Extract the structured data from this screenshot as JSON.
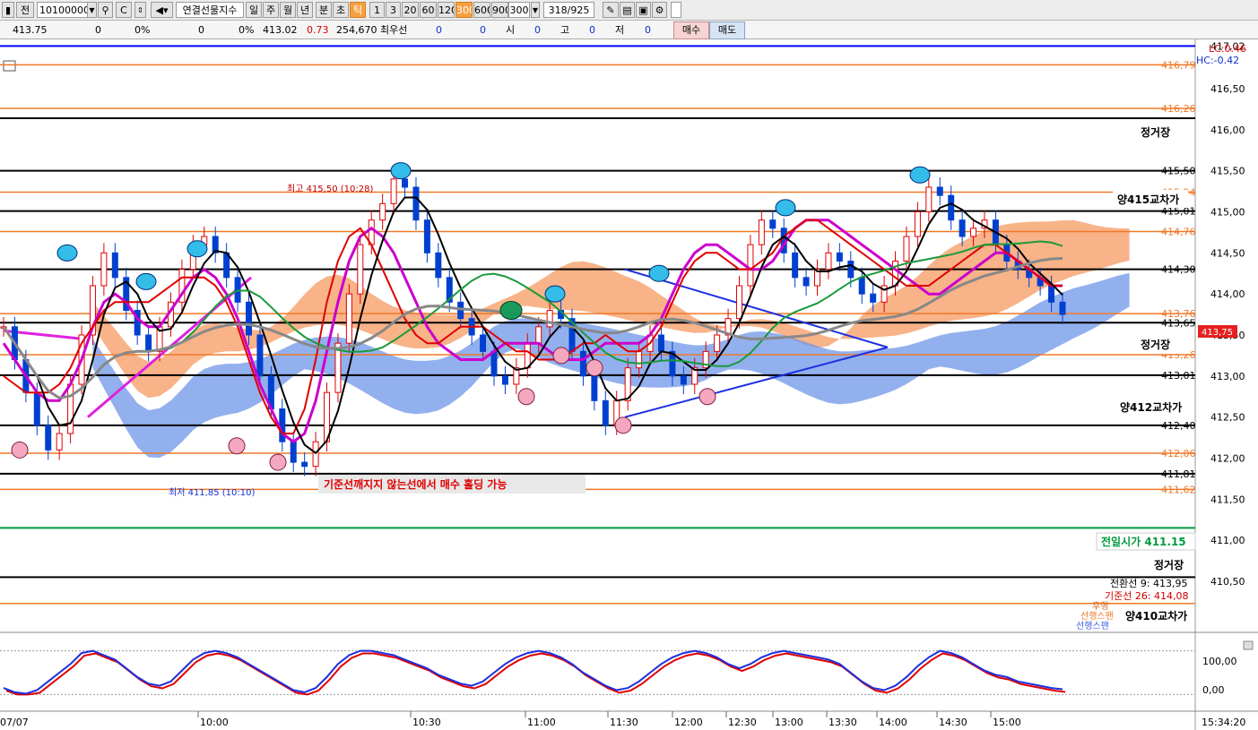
{
  "toolbar": {
    "code": "10100000",
    "name": "연결선물지수",
    "jeon_label": "전",
    "periods": [
      "일",
      "주",
      "월",
      "년",
      "분",
      "초",
      "틱"
    ],
    "intervals": [
      "1",
      "3",
      "20",
      "60",
      "120",
      "300",
      "600",
      "900"
    ],
    "selected_interval": "300",
    "interval_value": "300",
    "bar_count": "318/925"
  },
  "quote": {
    "current": "413.75",
    "v1": "0",
    "p1": "0%",
    "v2": "0",
    "p2": "0%",
    "price": "413.02",
    "change": "0.73",
    "volume": "254,670",
    "best_label": "최우선",
    "best_v1": "0",
    "best_v2": "0",
    "open_label": "시",
    "open": "0",
    "high_label": "고",
    "high": "0",
    "low_label": "저",
    "low": "0",
    "buy_label": "매수",
    "sell_label": "매도"
  },
  "colors": {
    "orange_line": "#f07828",
    "blue_line": "#0000ff",
    "green_line": "#009a3e",
    "current_price_bg": "#e62020",
    "candle_up": "#e00000",
    "candle_down": "#0040d0"
  },
  "chart_data": {
    "type": "line",
    "title": "",
    "ylim": [
      409.9,
      417.1
    ],
    "y_ticks": [
      "417,02",
      "416,50",
      "416,00",
      "415,50",
      "415,00",
      "414,50",
      "414,00",
      "413,50",
      "413,00",
      "412,50",
      "412,00",
      "411,50",
      "411,00",
      "410,50"
    ],
    "x_ticks": [
      "07/07",
      "10:00",
      "10:30",
      "11:00",
      "11:30",
      "12:00",
      "12:30",
      "13:00",
      "13:30",
      "14:00",
      "14:30",
      "15:00",
      "15:34:20"
    ],
    "price_scale_labels": {
      "lc": "LC:0.46",
      "hc": "HC:-0.42",
      "o1": "416,79",
      "o2": "416,26",
      "o3": "415,24",
      "o4": "414,76",
      "o5": "413,76",
      "o6": "413,26",
      "o7": "412,06",
      "o8": "411,62",
      "b1": "415,50",
      "b2": "415,01",
      "b3": "414,30",
      "b4": "413,01",
      "b5": "412,40",
      "b6": "411,81",
      "b7": "413,65",
      "pct": "0.00%"
    },
    "current_price": "413,75",
    "horizontal_lines": [
      {
        "color": "blue",
        "value": 417.02
      },
      {
        "color": "orange",
        "value": 416.79
      },
      {
        "color": "orange",
        "value": 416.26
      },
      {
        "color": "black",
        "value": 416.14
      },
      {
        "color": "black",
        "value": 415.5
      },
      {
        "color": "orange",
        "value": 415.24
      },
      {
        "color": "black",
        "value": 415.01
      },
      {
        "color": "orange",
        "value": 414.76
      },
      {
        "color": "black",
        "value": 414.3
      },
      {
        "color": "orange",
        "value": 413.76
      },
      {
        "color": "black",
        "value": 413.65
      },
      {
        "color": "orange",
        "value": 413.26
      },
      {
        "color": "black",
        "value": 413.01
      },
      {
        "color": "black",
        "value": 412.4
      },
      {
        "color": "orange",
        "value": 412.06
      },
      {
        "color": "black",
        "value": 411.81
      },
      {
        "color": "orange",
        "value": 411.62
      },
      {
        "color": "green",
        "value": 411.15
      },
      {
        "color": "black",
        "value": 410.55
      },
      {
        "color": "orange",
        "value": 410.23
      }
    ],
    "annotations": {
      "regular1": "정거장",
      "regular2": "정거장",
      "regular3": "정거장",
      "cross415": "양415교차가",
      "cross412": "양412교차가",
      "cross410": "양410교차가",
      "prev_close": "전일시가 411.15",
      "high_note": "최고 415,50 (10:28)",
      "low_note": "최저 411,85 (10:10)",
      "strategy": "기준선깨지지 않는선에서 매수 홀딩 가능",
      "conv": "전환선 9: 413,95",
      "base": "기준선 26: 414,08",
      "lead1": "후행",
      "lead2": "선행스팬",
      "lead3": "선행스팬"
    },
    "prices": [
      413.6,
      413.2,
      412.8,
      412.4,
      412.1,
      412.3,
      412.9,
      413.5,
      414.1,
      414.5,
      414.2,
      413.8,
      413.5,
      413.3,
      413.6,
      413.9,
      414.3,
      414.6,
      414.7,
      414.5,
      414.2,
      413.9,
      413.5,
      413.0,
      412.6,
      412.2,
      411.95,
      411.9,
      412.2,
      412.8,
      413.4,
      414.0,
      414.6,
      414.9,
      415.1,
      415.4,
      415.3,
      414.9,
      414.5,
      414.2,
      413.9,
      413.7,
      413.5,
      413.3,
      413.0,
      412.9,
      413.1,
      413.4,
      413.6,
      413.8,
      413.7,
      413.3,
      413.0,
      412.7,
      412.4,
      412.7,
      413.1,
      413.3,
      413.5,
      413.3,
      413.0,
      412.9,
      413.1,
      413.3,
      413.5,
      413.7,
      414.1,
      414.6,
      414.9,
      414.8,
      414.5,
      414.2,
      414.1,
      414.3,
      414.5,
      414.4,
      414.2,
      414.0,
      413.9,
      414.1,
      414.4,
      414.7,
      415.0,
      415.3,
      415.2,
      414.9,
      414.7,
      414.8,
      414.9,
      414.6,
      414.4,
      414.3,
      414.2,
      414.1,
      413.9,
      413.75
    ],
    "series": [
      {
        "values": [
          413.4,
          413.2,
          413.0,
          412.8,
          412.7,
          412.7,
          412.9,
          413.2,
          413.6,
          413.9,
          414.0,
          413.9,
          413.7,
          413.6,
          413.6,
          413.8,
          414.0,
          414.2,
          414.3,
          414.2,
          414.0,
          413.7,
          413.3,
          412.9,
          412.6,
          412.3,
          412.2,
          412.3,
          412.7,
          413.3,
          413.9,
          414.4,
          414.7,
          414.8,
          414.7,
          414.5,
          414.2,
          413.9,
          413.6,
          413.4,
          413.3,
          413.2,
          413.2,
          413.2,
          413.3,
          413.4,
          413.4,
          413.4,
          413.4,
          413.3,
          413.2,
          413.2,
          413.2,
          413.3,
          413.4,
          413.4,
          413.4,
          413.4,
          413.5,
          413.7,
          414.0,
          414.3,
          414.5,
          414.6,
          414.6,
          414.5,
          414.4,
          414.3,
          414.3,
          414.4,
          414.6,
          414.8,
          414.9,
          414.9,
          414.9,
          414.8,
          414.7,
          414.6,
          414.5,
          414.4,
          414.3,
          414.2,
          414.1,
          414.0,
          414.0,
          414.1,
          414.2,
          414.3,
          414.4,
          414.5,
          414.5,
          414.4,
          414.3,
          414.2,
          414.1,
          414.1
        ]
      },
      {
        "values": [
          413.0,
          412.9,
          412.8,
          412.8,
          412.8,
          412.9,
          413.1,
          413.4,
          413.6,
          413.8,
          413.9,
          413.9,
          413.9,
          413.9,
          414.0,
          414.1,
          414.2,
          414.2,
          414.2,
          414.1,
          413.9,
          413.6,
          413.2,
          412.8,
          412.5,
          412.3,
          412.3,
          412.6,
          413.2,
          413.9,
          414.4,
          414.7,
          414.8,
          414.6,
          414.3,
          414.0,
          413.7,
          413.5,
          413.4,
          413.4,
          413.5,
          413.6,
          413.6,
          413.6,
          413.5,
          413.4,
          413.3,
          413.3,
          413.2,
          413.2,
          413.2,
          413.3,
          413.4,
          413.4,
          413.5,
          413.4,
          413.3,
          413.3,
          413.4,
          413.6,
          413.9,
          414.2,
          414.4,
          414.5,
          414.5,
          414.4,
          414.3,
          414.3,
          414.4,
          414.5,
          414.7,
          414.8,
          414.9,
          414.9,
          414.8,
          414.7,
          414.6,
          414.5,
          414.4,
          414.3,
          414.2,
          414.1,
          414.1,
          414.1,
          414.2,
          414.3,
          414.4,
          414.5,
          414.6,
          414.6,
          414.5,
          414.4,
          414.3,
          414.2,
          414.1,
          414.1
        ]
      }
    ],
    "stochastic": {
      "ylim": [
        -30,
        130
      ],
      "ticks": [
        "100,00",
        "0,00"
      ],
      "values": [
        15,
        5,
        2,
        10,
        30,
        50,
        70,
        95,
        100,
        90,
        80,
        60,
        40,
        25,
        20,
        30,
        55,
        80,
        95,
        100,
        95,
        85,
        70,
        55,
        40,
        25,
        10,
        5,
        15,
        40,
        70,
        90,
        100,
        100,
        95,
        90,
        80,
        70,
        60,
        45,
        35,
        25,
        20,
        30,
        50,
        70,
        85,
        95,
        100,
        95,
        85,
        70,
        50,
        35,
        20,
        10,
        15,
        30,
        50,
        70,
        85,
        95,
        100,
        95,
        85,
        70,
        60,
        70,
        85,
        95,
        100,
        95,
        90,
        85,
        80,
        70,
        50,
        30,
        15,
        10,
        20,
        40,
        65,
        85,
        100,
        95,
        85,
        70,
        55,
        45,
        40,
        30,
        25,
        20,
        15,
        12
      ]
    }
  }
}
